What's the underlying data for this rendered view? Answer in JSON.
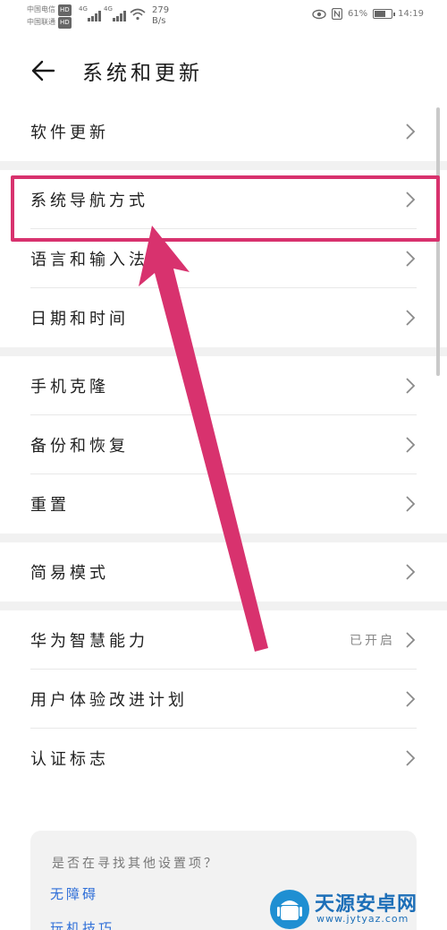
{
  "status_bar": {
    "carrier1": "中国电信",
    "carrier2": "中国联通",
    "hd": "HD",
    "net1": "4G",
    "net2": "4G",
    "speed_value": "279",
    "speed_unit": "B/s",
    "battery_pct": "61%",
    "time": "14:19",
    "battery_level": 0.61
  },
  "header": {
    "title": "系统和更新"
  },
  "groups": [
    {
      "items": [
        {
          "label": "软件更新"
        }
      ]
    },
    {
      "items": [
        {
          "label": "系统导航方式"
        },
        {
          "label": "语言和输入法"
        },
        {
          "label": "日期和时间"
        }
      ]
    },
    {
      "items": [
        {
          "label": "手机克隆"
        },
        {
          "label": "备份和恢复"
        },
        {
          "label": "重置"
        }
      ]
    },
    {
      "items": [
        {
          "label": "简易模式"
        }
      ]
    },
    {
      "items": [
        {
          "label": "华为智慧能力",
          "value": "已开启"
        },
        {
          "label": "用户体验改进计划"
        },
        {
          "label": "认证标志"
        }
      ]
    }
  ],
  "suggestions": {
    "question": "是否在寻找其他设置项？",
    "links": [
      "无障碍",
      "玩机技巧"
    ]
  },
  "annotation": {
    "highlight_color": "#d8326e"
  },
  "watermark": {
    "title": "天源安卓网",
    "url": "www.jytyaz.com"
  }
}
